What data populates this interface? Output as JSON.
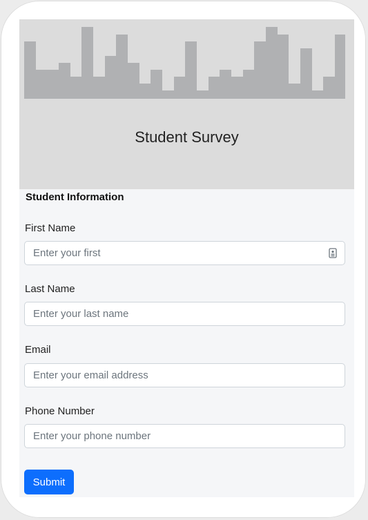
{
  "header": {
    "title": "Student Survey",
    "banner": "city-skyline-banner"
  },
  "form": {
    "section_title": "Student Information",
    "fields": [
      {
        "label": "First Name",
        "placeholder": "Enter your first",
        "value": ""
      },
      {
        "label": "Last Name",
        "placeholder": "Enter your last name",
        "value": ""
      },
      {
        "label": "Email",
        "placeholder": "Enter your email address",
        "value": ""
      },
      {
        "label": "Phone Number",
        "placeholder": "Enter your phone number",
        "value": ""
      }
    ],
    "submit_label": "Submit"
  },
  "icons": {
    "autofill": "contact-card-icon"
  },
  "colors": {
    "header_bg": "#dcdcdc",
    "skyline": "#b0b1b3",
    "form_bg": "#f5f6f8",
    "button_bg": "#0d6efd",
    "button_text": "#ffffff"
  }
}
